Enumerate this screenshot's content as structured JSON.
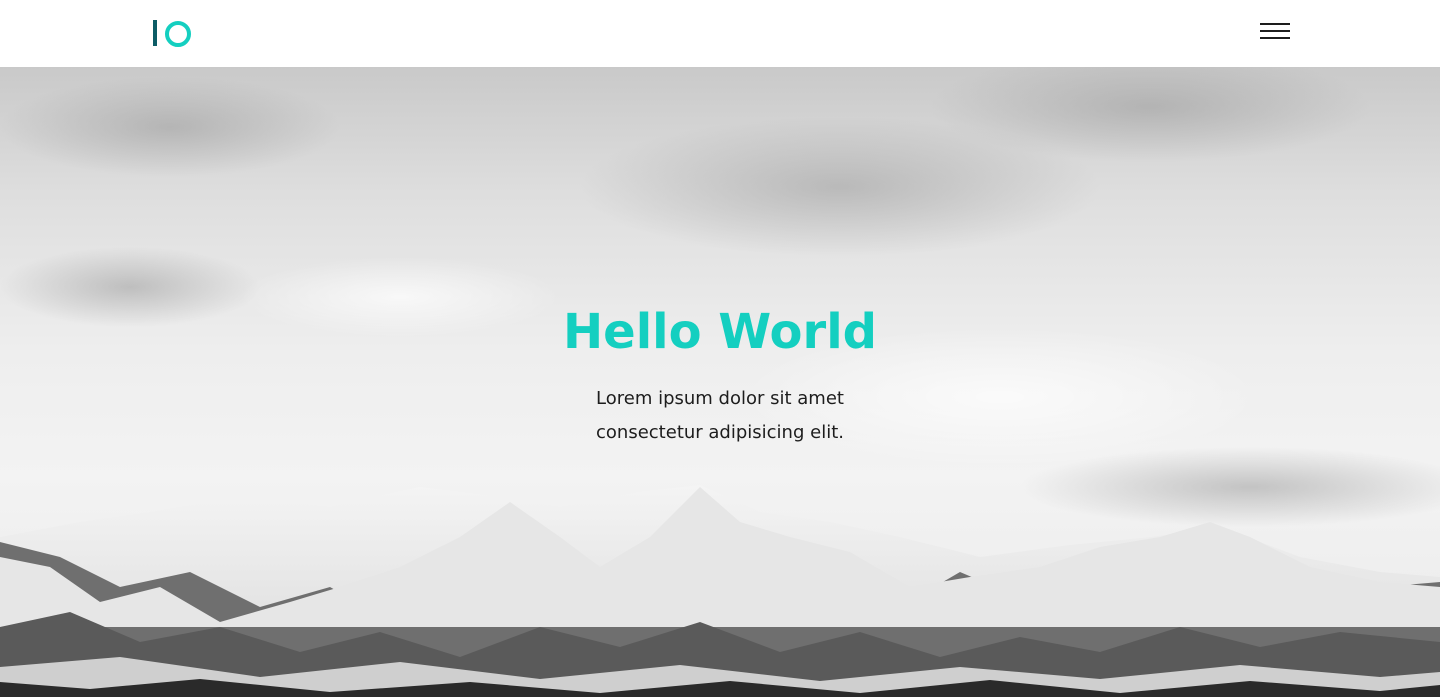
{
  "header": {
    "logo_icon": "io-logo-icon",
    "menu_icon": "hamburger-menu-icon"
  },
  "hero": {
    "title": "Hello World",
    "text": "Lorem ipsum dolor sit amet consectetur adipisicing elit."
  },
  "colors": {
    "accent": "#14cfc0",
    "logo_dark": "#0c5c66",
    "text": "#1d1d1d"
  }
}
